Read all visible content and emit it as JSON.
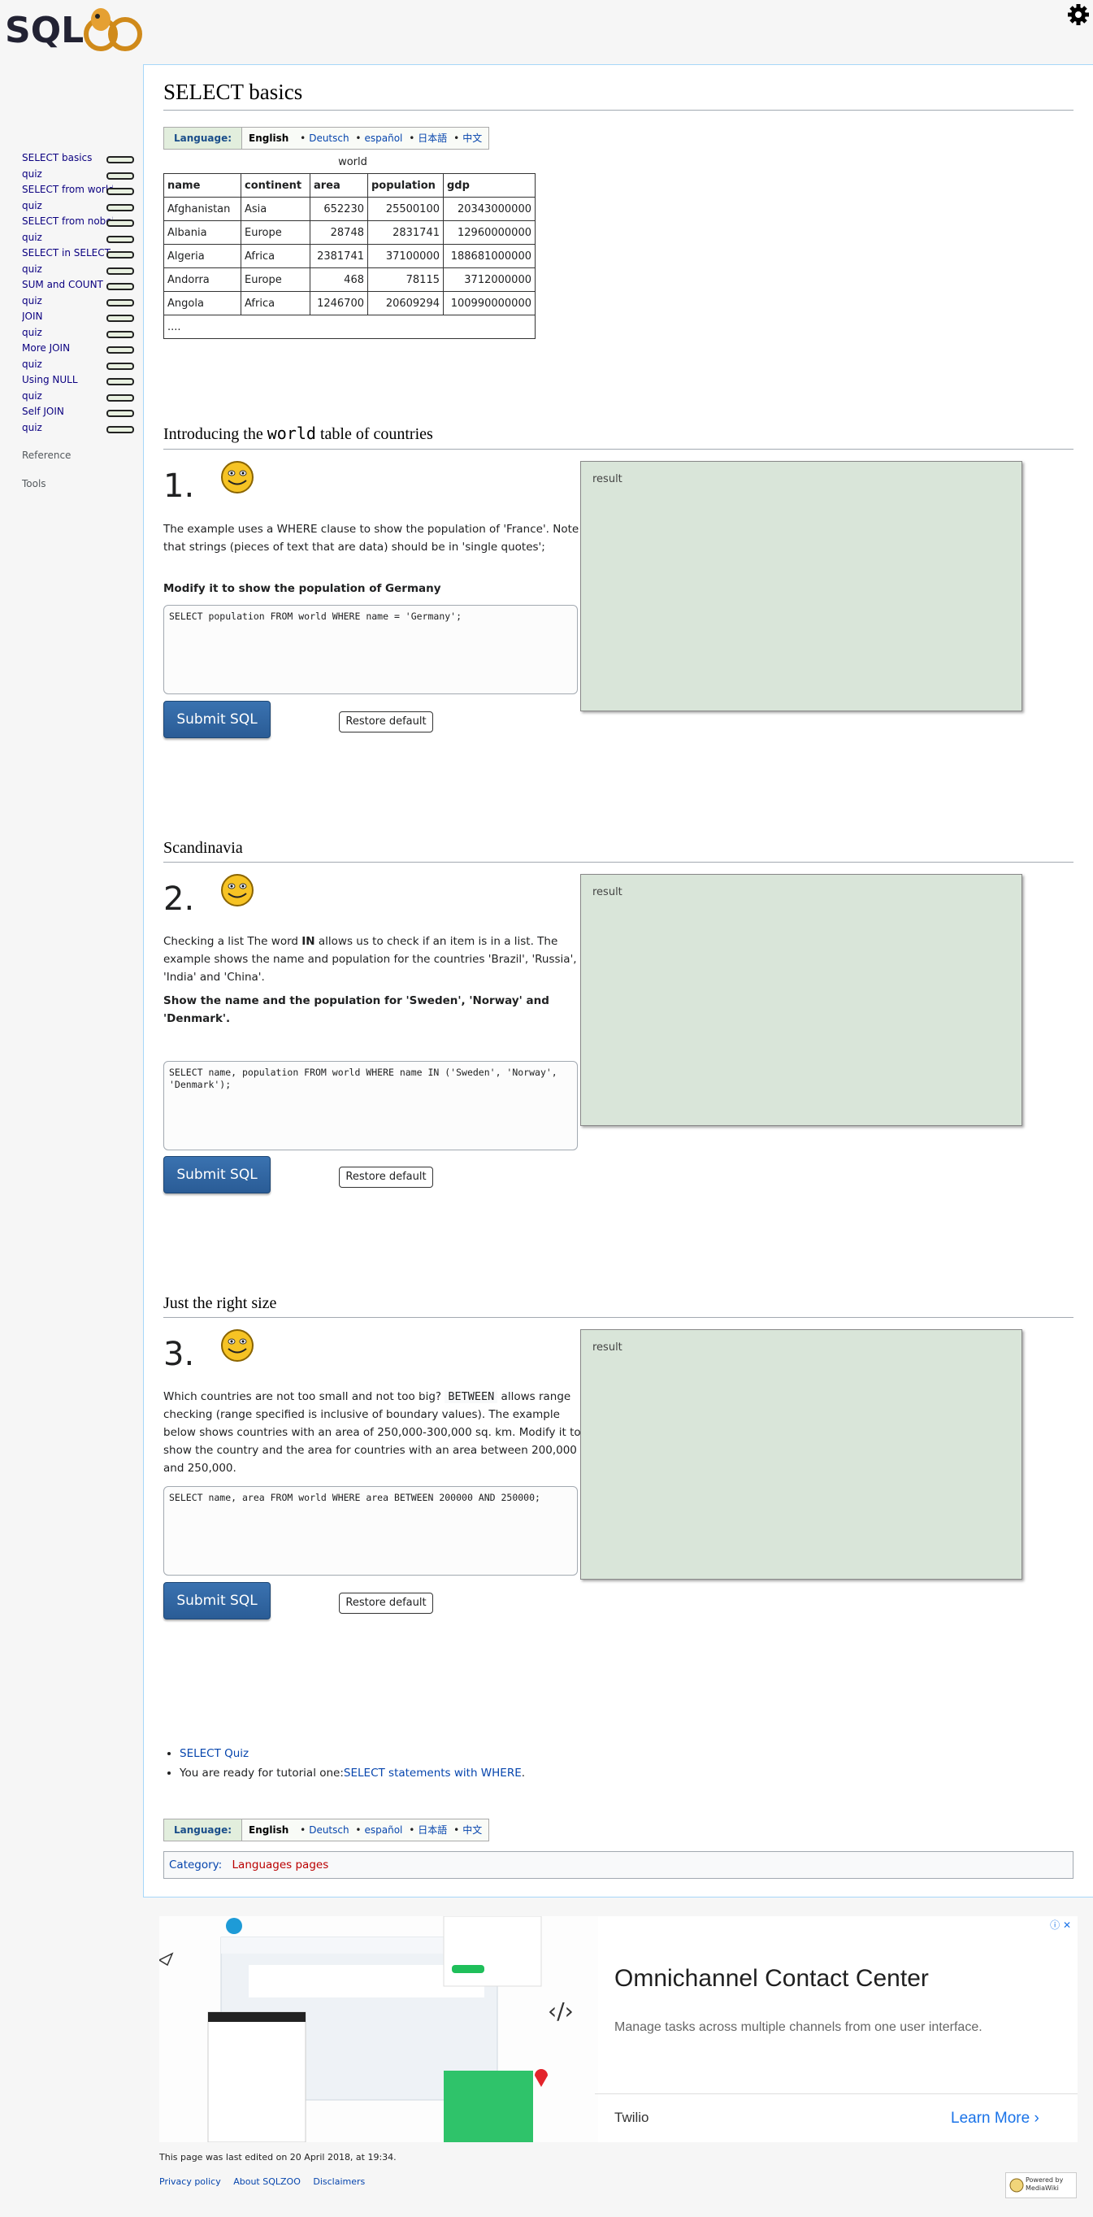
{
  "site": {
    "logo_text": "SQL"
  },
  "sidebar": {
    "items": [
      {
        "label": "SELECT basics"
      },
      {
        "label": "quiz"
      },
      {
        "label": "SELECT from world"
      },
      {
        "label": "quiz"
      },
      {
        "label": "SELECT from nobel"
      },
      {
        "label": "quiz"
      },
      {
        "label": "SELECT in SELECT"
      },
      {
        "label": "quiz"
      },
      {
        "label": "SUM and COUNT"
      },
      {
        "label": "quiz"
      },
      {
        "label": "JOIN"
      },
      {
        "label": "quiz"
      },
      {
        "label": "More JOIN"
      },
      {
        "label": "quiz"
      },
      {
        "label": "Using NULL"
      },
      {
        "label": "quiz"
      },
      {
        "label": "Self JOIN"
      },
      {
        "label": "quiz"
      }
    ],
    "reference": "Reference",
    "tools": "Tools"
  },
  "page": {
    "title": "SELECT basics",
    "language": {
      "label": "Language:",
      "current": "English",
      "others": [
        "Deutsch",
        "español",
        "日本語",
        "中文"
      ]
    },
    "table": {
      "caption": "world",
      "columns": [
        "name",
        "continent",
        "area",
        "population",
        "gdp"
      ],
      "rows": [
        [
          "Afghanistan",
          "Asia",
          "652230",
          "25500100",
          "20343000000"
        ],
        [
          "Albania",
          "Europe",
          "28748",
          "2831741",
          "12960000000"
        ],
        [
          "Algeria",
          "Africa",
          "2381741",
          "37100000",
          "188681000000"
        ],
        [
          "Andorra",
          "Europe",
          "468",
          "78115",
          "3712000000"
        ],
        [
          "Angola",
          "Africa",
          "1246700",
          "20609294",
          "100990000000"
        ]
      ],
      "more": "...."
    },
    "intro": {
      "prefix": "Introducing the ",
      "code": "world",
      "suffix": " table of countries"
    },
    "questions": [
      {
        "number": "1.",
        "text": "The example uses a WHERE clause to show the population of 'France'. Note that strings (pieces of text that are data) should be in 'single quotes';",
        "task": "Modify it to show the population of Germany",
        "sql": "SELECT population FROM world WHERE name = 'Germany';",
        "submit": "Submit SQL",
        "restore": "Restore default",
        "result": "result"
      },
      {
        "heading": "Scandinavia",
        "number": "2.",
        "text_pre": "Checking a list The word ",
        "text_kw": "IN",
        "text_post": " allows us to check if an item is in a list. The example shows the name and population for the countries 'Brazil', 'Russia', 'India' and 'China'.",
        "task": "Show the name and the population for 'Sweden', 'Norway' and 'Denmark'.",
        "sql": "SELECT name, population FROM world WHERE name IN ('Sweden', 'Norway', 'Denmark');",
        "submit": "Submit SQL",
        "restore": "Restore default",
        "result": "result"
      },
      {
        "heading": "Just the right size",
        "number": "3.",
        "text_pre": "Which countries are not too small and not too big? ",
        "text_kw": "BETWEEN",
        "text_post": " allows range checking (range specified is inclusive of boundary values). The example below shows countries with an area of 250,000-300,000 sq. km. Modify it to show the country and the area for countries with an area between 200,000 and 250,000.",
        "sql": "SELECT name, area FROM world WHERE area BETWEEN 200000 AND 250000;",
        "submit": "Submit SQL",
        "restore": "Restore default",
        "result": "result"
      }
    ],
    "footer_list": {
      "quiz": "SELECT Quiz",
      "ready_text": "You are ready for tutorial one:",
      "ready_link": "SELECT statements with WHERE",
      "period": "."
    },
    "category": {
      "label": "Category:",
      "value": "Languages pages"
    }
  },
  "ad": {
    "title": "Omnichannel Contact Center",
    "subtitle": "Manage tasks across multiple channels from one user interface.",
    "brand": "Twilio",
    "cta": "Learn More"
  },
  "footer": {
    "edited": "This page was last edited on 20 April 2018, at 19:34.",
    "links": [
      "Privacy policy",
      "About SQLZOO",
      "Disclaimers"
    ],
    "badge": "Powered by MediaWiki"
  }
}
